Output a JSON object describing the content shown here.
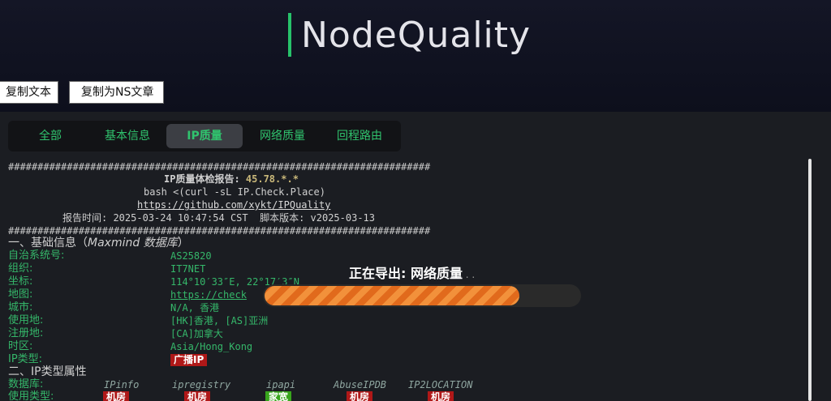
{
  "brand": {
    "title": "NodeQuality",
    "accent": "#27c26a"
  },
  "toolbar": {
    "copy_text": "复制文本",
    "copy_ns": "复制为NS文章"
  },
  "tabs": [
    {
      "label": "全部",
      "active": false
    },
    {
      "label": "基本信息",
      "active": false
    },
    {
      "label": "IP质量",
      "active": true
    },
    {
      "label": "网络质量",
      "active": false
    },
    {
      "label": "回程路由",
      "active": false
    }
  ],
  "report": {
    "hash_line": "########################################################################",
    "title": "IP质量体检报告: ",
    "ip": "45.78.*.*",
    "command": "bash <(curl -sL IP.Check.Place)",
    "url": "https://github.com/xykt/IPQuality",
    "time_label": "报告时间: ",
    "time_value": "2025-03-24 10:47:54 CST",
    "version_label": "  脚本版本: ",
    "version_value": "v2025-03-13",
    "section1": "一、基础信息（",
    "section1_db": "Maxmind 数据库",
    "section1_end": "）",
    "fields": [
      {
        "label": "自治系统号:",
        "value": "AS25820"
      },
      {
        "label": "组织:",
        "value": "IT7NET"
      },
      {
        "label": "坐标:",
        "value": "114°10′33″E, 22°17′3″N"
      },
      {
        "label": "地图:",
        "value": "https://check"
      },
      {
        "label": "城市:",
        "value": "N/A, 香港"
      },
      {
        "label": "使用地:",
        "value": "[HK]香港, [AS]亚洲"
      },
      {
        "label": "注册地:",
        "value": "[CA]加拿大"
      },
      {
        "label": "时区:",
        "value": "Asia/Hong_Kong"
      }
    ],
    "ip_type_label": "IP类型:",
    "ip_type_value": "广播IP",
    "section2": "二、IP类型属性",
    "db_label": "数据库:",
    "databases": [
      "IPinfo",
      "ipregistry",
      "ipapi",
      "AbuseIPDB",
      "IP2LOCATION"
    ],
    "usage_label": "使用类型:",
    "usage": [
      {
        "value": "机房",
        "color": "#b01818"
      },
      {
        "value": "机房",
        "color": "#b01818"
      },
      {
        "value": "家宽",
        "color": "#38a51c"
      },
      {
        "value": "机房",
        "color": "#b01818"
      },
      {
        "value": "机房",
        "color": "#b01818"
      }
    ]
  },
  "export": {
    "title": "正在导出: 网络质量",
    "dots": " . .",
    "progress": 0.81
  }
}
